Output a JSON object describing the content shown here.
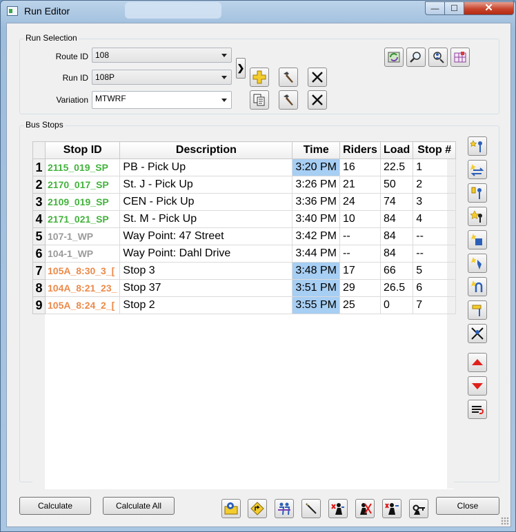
{
  "window": {
    "title": "Run Editor",
    "min": "—",
    "max": "☐",
    "close": "✕"
  },
  "run_selection": {
    "group_label": "Run Selection",
    "route_label": "Route ID",
    "route_value": "108",
    "run_label": "Run ID",
    "run_value": "108P",
    "variation_label": "Variation",
    "variation_value": "MTWRF",
    "expand": "❯"
  },
  "bus_stops": {
    "group_label": "Bus Stops",
    "columns": [
      "Stop ID",
      "Description",
      "Time",
      "Riders",
      "Load",
      "Stop #"
    ],
    "rows": [
      {
        "num": "1",
        "stop_id": "2115_019_SP",
        "kind": "sp",
        "desc": "PB - Pick Up",
        "time": "3:20 PM",
        "time_selected": true,
        "riders": "16",
        "load": "22.5",
        "stop": "1"
      },
      {
        "num": "2",
        "stop_id": "2170_017_SP",
        "kind": "sp",
        "desc": "St. J - Pick Up",
        "time": "3:26 PM",
        "time_selected": false,
        "riders": "21",
        "load": "50",
        "stop": "2"
      },
      {
        "num": "3",
        "stop_id": "2109_019_SP",
        "kind": "sp",
        "desc": "CEN - Pick Up",
        "time": "3:36 PM",
        "time_selected": false,
        "riders": "24",
        "load": "74",
        "stop": "3"
      },
      {
        "num": "4",
        "stop_id": "2171_021_SP",
        "kind": "sp",
        "desc": "St. M - Pick Up",
        "time": "3:40 PM",
        "time_selected": false,
        "riders": "10",
        "load": "84",
        "stop": "4"
      },
      {
        "num": "5",
        "stop_id": "107-1_WP",
        "kind": "wp",
        "desc": "Way Point: 47 Street",
        "time": "3:42 PM",
        "time_selected": false,
        "riders": "--",
        "load": "84",
        "stop": "--"
      },
      {
        "num": "6",
        "stop_id": "104-1_WP",
        "kind": "wp",
        "desc": "Way Point: Dahl Drive",
        "time": "3:44 PM",
        "time_selected": false,
        "riders": "--",
        "load": "84",
        "stop": "--"
      },
      {
        "num": "7",
        "stop_id": "105A_8:30_3_[",
        "kind": "st",
        "desc": "Stop 3",
        "time": "3:48 PM",
        "time_selected": true,
        "riders": "17",
        "load": "66",
        "stop": "5"
      },
      {
        "num": "8",
        "stop_id": "104A_8:21_23_",
        "kind": "st",
        "desc": "Stop 37",
        "time": "3:51 PM",
        "time_selected": true,
        "riders": "29",
        "load": "26.5",
        "stop": "6"
      },
      {
        "num": "9",
        "stop_id": "105A_8:24_2_[",
        "kind": "st",
        "desc": "Stop 2",
        "time": "3:55 PM",
        "time_selected": true,
        "riders": "25",
        "load": "0",
        "stop": "7"
      }
    ]
  },
  "footer": {
    "calculate": "Calculate",
    "calculate_all": "Calculate All",
    "close": "Close"
  },
  "colors": {
    "sp": "#43b33c",
    "wp": "#9b9b9b",
    "st": "#ec8a4a",
    "selected": "#a7cef3"
  },
  "icons": {
    "top_tools": [
      "refresh-map-icon",
      "search-icon",
      "locate-person-icon",
      "grid-map-icon"
    ],
    "run_tools": [
      "add-icon",
      "edit-hammer-icon",
      "delete-icon",
      "copy-icon",
      "edit-hammer-icon",
      "delete-icon"
    ],
    "side_tools": [
      "add-stop-icon",
      "swap-stop-icon",
      "insert-stop-icon",
      "star-stop-icon",
      "blue-stop-icon",
      "blue-pin-icon",
      "reroute-stop-icon",
      "yellow-pin-icon",
      "remove-stop-icon",
      "move-up-icon",
      "move-down-icon",
      "reorder-list-icon"
    ],
    "bottom_tools": [
      "pin-map-icon",
      "direction-icon",
      "students-icon",
      "wand-icon",
      "reassign-icon",
      "remove-students-icon",
      "assign-students-icon",
      "key-person-icon"
    ]
  }
}
